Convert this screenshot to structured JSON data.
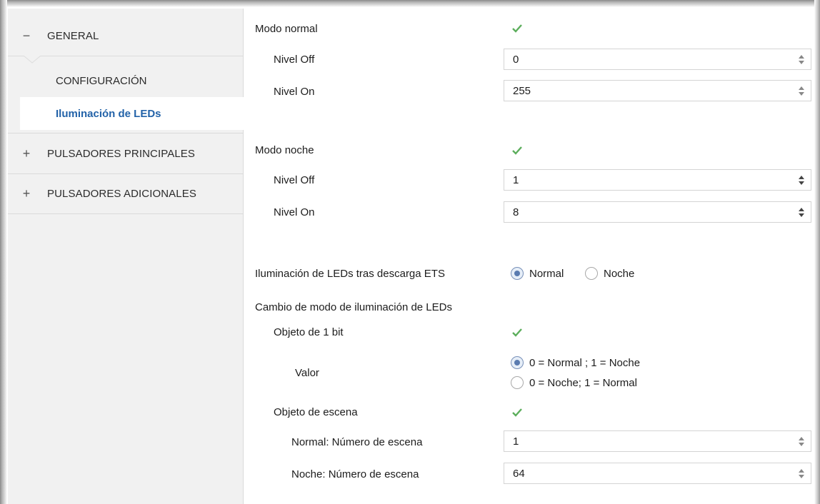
{
  "sidebar": {
    "general": {
      "sign": "−",
      "label": "GENERAL"
    },
    "configuracion": {
      "label": "CONFIGURACIÓN"
    },
    "iluminacion_leds": {
      "label": "Iluminación de LEDs"
    },
    "pulsadores_principales": {
      "sign": "+",
      "label": "PULSADORES PRINCIPALES"
    },
    "pulsadores_adicionales": {
      "sign": "+",
      "label": "PULSADORES ADICIONALES"
    }
  },
  "main": {
    "modo_normal": {
      "label": "Modo normal",
      "checked": true,
      "nivel_off": {
        "label": "Nivel Off",
        "value": "0"
      },
      "nivel_on": {
        "label": "Nivel On",
        "value": "255"
      }
    },
    "modo_noche": {
      "label": "Modo noche",
      "checked": true,
      "nivel_off": {
        "label": "Nivel Off",
        "value": "1"
      },
      "nivel_on": {
        "label": "Nivel On",
        "value": "8"
      }
    },
    "tras_descarga": {
      "label": "Iluminación de LEDs tras descarga ETS",
      "options": [
        "Normal",
        "Noche"
      ],
      "selected": "Normal"
    },
    "cambio_modo": {
      "label": "Cambio de modo de iluminación de LEDs",
      "objeto_1bit": {
        "label": "Objeto de 1 bit",
        "checked": true
      },
      "valor": {
        "label": "Valor",
        "options": [
          "0 = Normal ; 1 = Noche",
          "0 = Noche; 1 = Normal"
        ],
        "selected": "0 = Normal ; 1 = Noche"
      },
      "objeto_escena": {
        "label": "Objeto de escena",
        "checked": true
      },
      "normal_escena": {
        "label": "Normal: Número de escena",
        "value": "1"
      },
      "noche_escena": {
        "label": "Noche: Número de escena",
        "value": "64"
      }
    }
  },
  "colors": {
    "accent_blue": "#2262a8",
    "check_green": "#5cae5c",
    "sidebar_bg": "#f1f1f1",
    "radio_selected": "#5a7bb0"
  },
  "icons": {
    "checkbox": "check-icon",
    "spinner": "spin-arrows-icon",
    "collapse": "minus-icon",
    "expand": "plus-icon"
  }
}
